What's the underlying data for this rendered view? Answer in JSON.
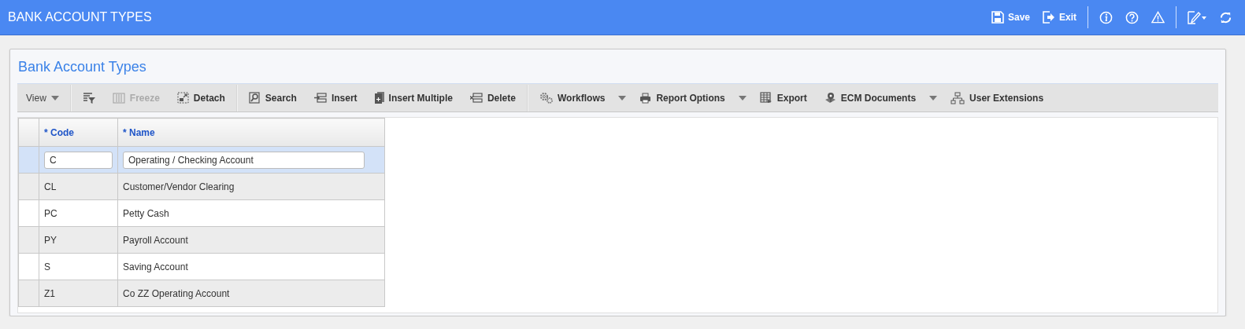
{
  "window": {
    "title": "BANK ACCOUNT TYPES"
  },
  "header_actions": [
    {
      "label": "Save"
    },
    {
      "label": "Exit"
    }
  ],
  "panel": {
    "title": "Bank Account Types"
  },
  "toolbar": [
    {
      "kind": "menu",
      "label": "View",
      "disabled": false,
      "dropdown": true
    },
    {
      "kind": "icon",
      "disabled": false,
      "dropdown": false
    },
    {
      "kind": "button",
      "label": "Freeze",
      "disabled": true,
      "dropdown": false
    },
    {
      "kind": "button",
      "label": "Detach",
      "disabled": false,
      "dropdown": false
    },
    {
      "kind": "button",
      "label": "Search",
      "disabled": false,
      "dropdown": false
    },
    {
      "kind": "button",
      "label": "Insert",
      "disabled": false,
      "dropdown": false
    },
    {
      "kind": "button",
      "label": "Insert Multiple",
      "disabled": false,
      "dropdown": false
    },
    {
      "kind": "button",
      "label": "Delete",
      "disabled": false,
      "dropdown": false
    },
    {
      "kind": "button",
      "label": "Workflows",
      "disabled": false,
      "dropdown": true
    },
    {
      "kind": "button",
      "label": "Report Options",
      "disabled": false,
      "dropdown": true
    },
    {
      "kind": "button",
      "label": "Export",
      "disabled": false,
      "dropdown": false
    },
    {
      "kind": "button",
      "label": "ECM Documents",
      "disabled": false,
      "dropdown": true
    },
    {
      "kind": "button",
      "label": "User Extensions",
      "disabled": false,
      "dropdown": false
    }
  ],
  "table": {
    "columns": [
      "* Code",
      "* Name"
    ],
    "rows": [
      {
        "code": "C",
        "name": "Operating / Checking Account",
        "selected": true
      },
      {
        "code": "CL",
        "name": "Customer/Vendor Clearing",
        "selected": false
      },
      {
        "code": "PC",
        "name": "Petty Cash",
        "selected": false
      },
      {
        "code": "PY",
        "name": "Payroll Account",
        "selected": false
      },
      {
        "code": "S",
        "name": "Saving Account",
        "selected": false
      },
      {
        "code": "Z1",
        "name": "Co ZZ Operating Account",
        "selected": false
      }
    ]
  }
}
